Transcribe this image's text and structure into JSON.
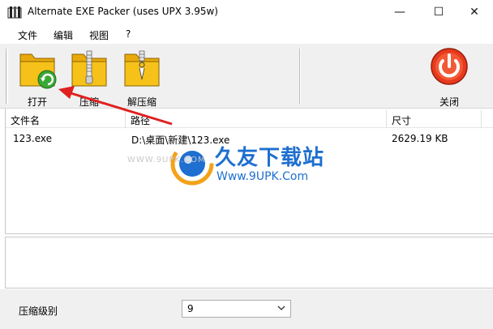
{
  "window": {
    "title": "Alternate EXE Packer (uses UPX 3.95w)",
    "minimize_glyph": "—",
    "maximize_glyph": "☐",
    "close_glyph": "✕"
  },
  "menu": {
    "items": [
      {
        "label": "文件"
      },
      {
        "label": "编辑"
      },
      {
        "label": "视图"
      },
      {
        "label": "?"
      }
    ]
  },
  "toolbar": {
    "open_label": "打开",
    "compress_label": "压缩",
    "decompress_label": "解压缩",
    "close_label": "关闭"
  },
  "file_list": {
    "columns": [
      "文件名",
      "路径",
      "尺寸"
    ],
    "rows": [
      {
        "name": "123.exe",
        "path": "D:\\桌面\\新建\\123.exe",
        "size": "2629.19 KB"
      }
    ]
  },
  "watermark": {
    "site_cn": "久友下载站",
    "site_url": "Www.9UPK.Com",
    "site_url_small": "WWW.9UPK.COM"
  },
  "bottom": {
    "level_label": "压缩级别",
    "level_value": "9"
  },
  "colors": {
    "folder_yellow": "#f6c21a",
    "open_badge_green": "#3aa835",
    "close_red": "#e8391e",
    "arrow_red": "#e02020",
    "watermark_blue": "#1e6fd0"
  }
}
